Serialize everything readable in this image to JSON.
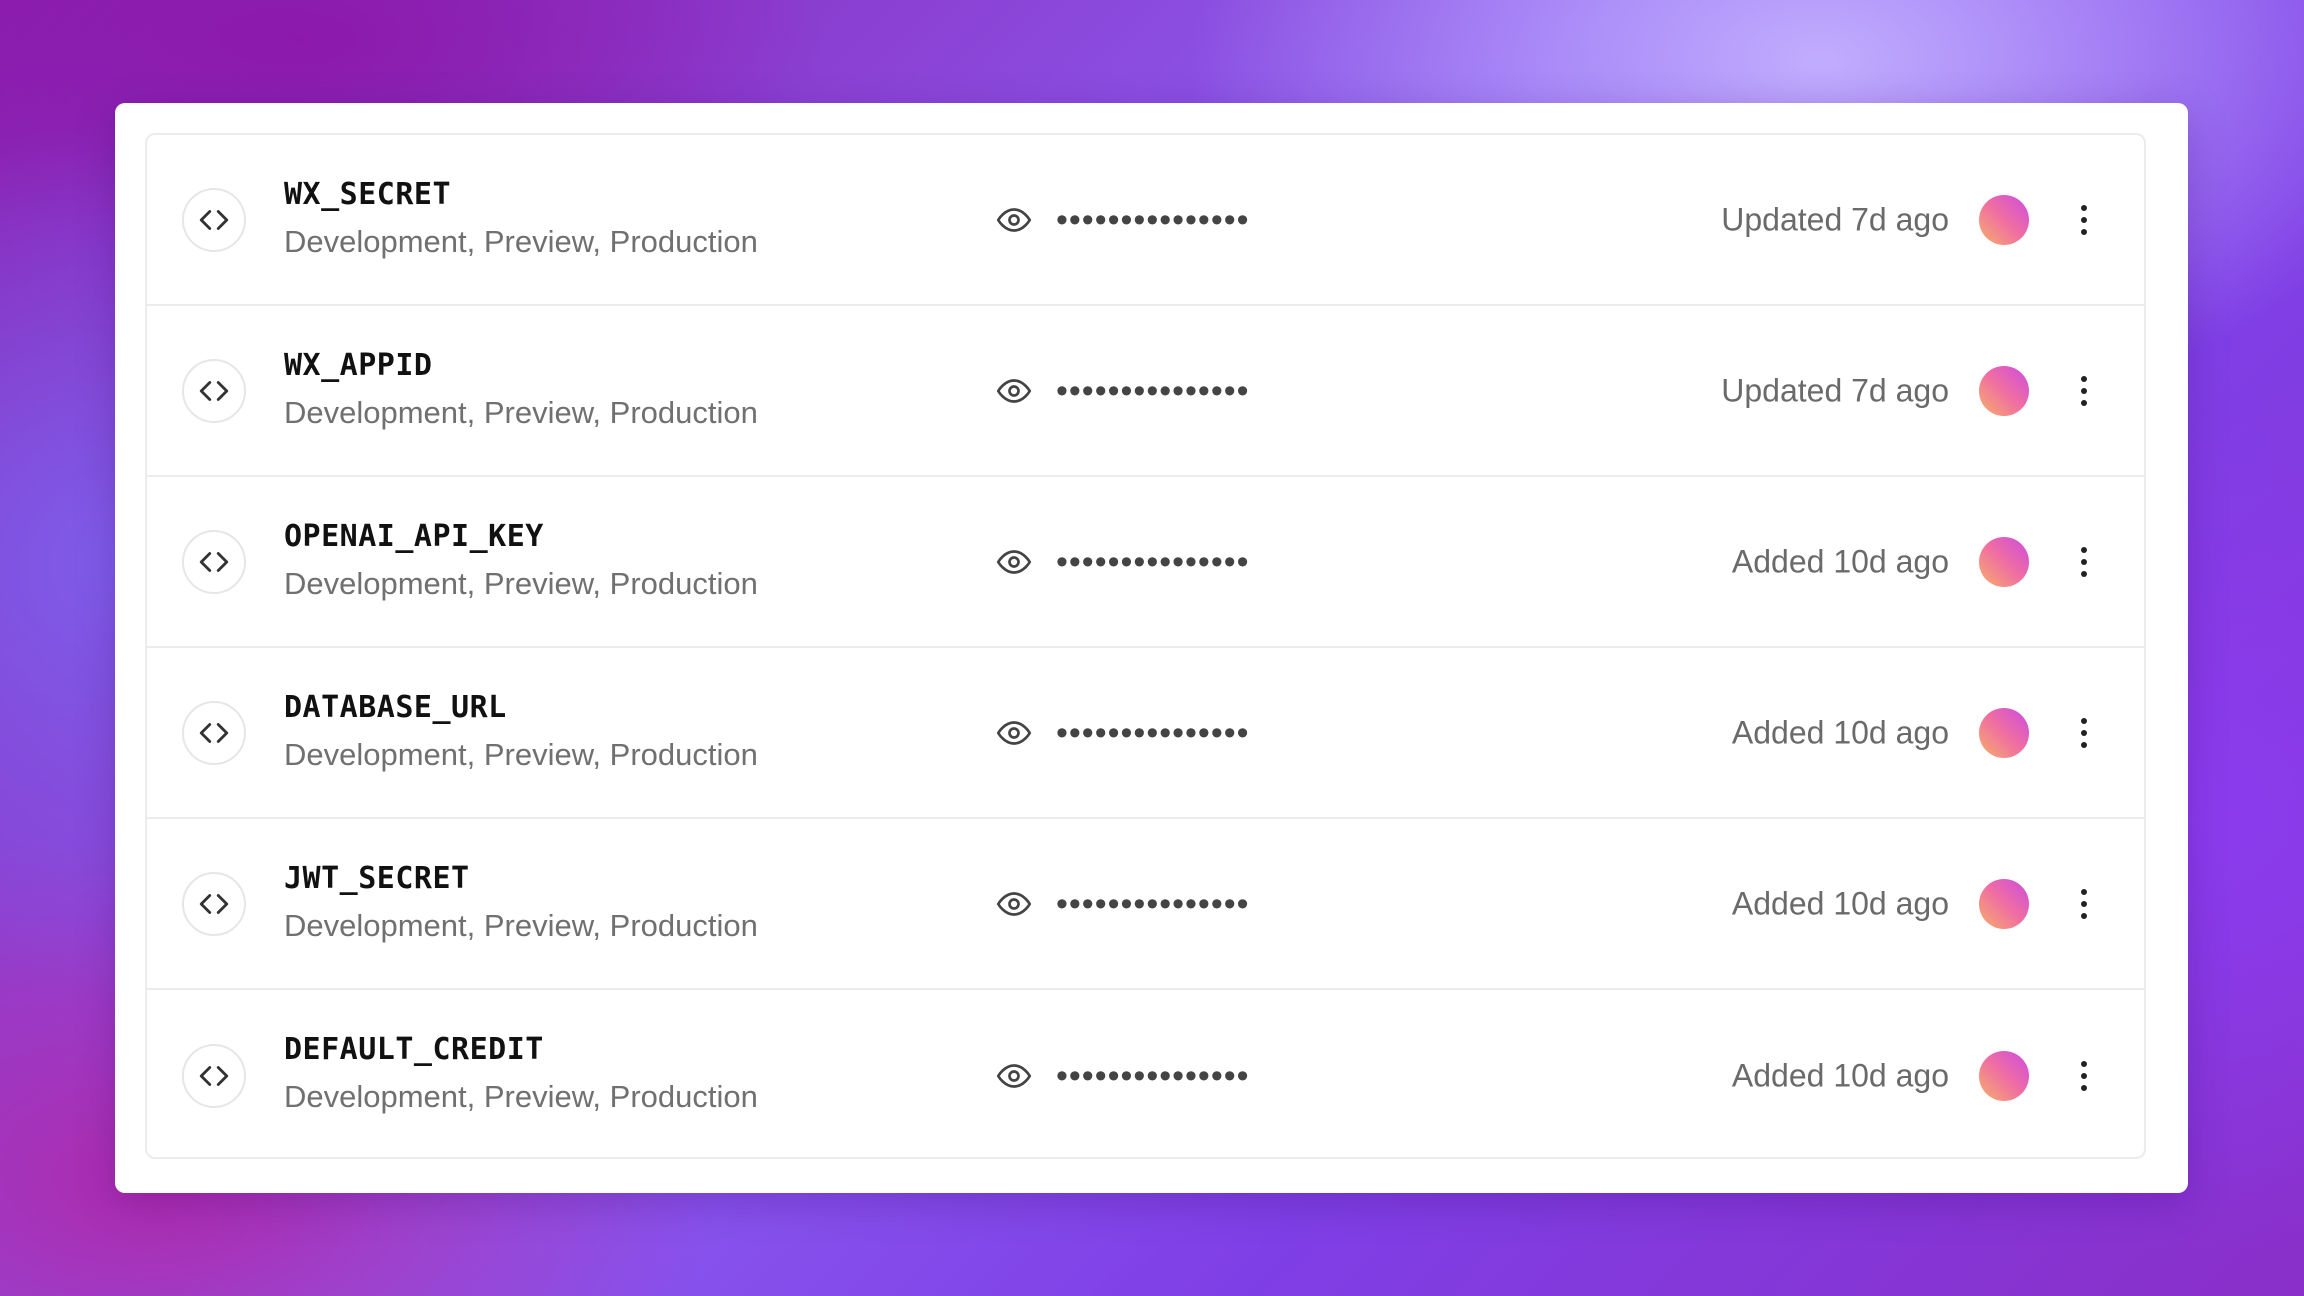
{
  "variables": [
    {
      "name": "WX_SECRET",
      "environments": "Development, Preview, Production",
      "masked_value": "•••••••••••••••",
      "status": "Updated 7d ago",
      "icons": {
        "badge": "code-brackets-icon",
        "reveal": "eye-icon",
        "menu": "more-vertical-icon"
      }
    },
    {
      "name": "WX_APPID",
      "environments": "Development, Preview, Production",
      "masked_value": "•••••••••••••••",
      "status": "Updated 7d ago",
      "icons": {
        "badge": "code-brackets-icon",
        "reveal": "eye-icon",
        "menu": "more-vertical-icon"
      }
    },
    {
      "name": "OPENAI_API_KEY",
      "environments": "Development, Preview, Production",
      "masked_value": "•••••••••••••••",
      "status": "Added 10d ago",
      "icons": {
        "badge": "code-brackets-icon",
        "reveal": "eye-icon",
        "menu": "more-vertical-icon"
      }
    },
    {
      "name": "DATABASE_URL",
      "environments": "Development, Preview, Production",
      "masked_value": "•••••••••••••••",
      "status": "Added 10d ago",
      "icons": {
        "badge": "code-brackets-icon",
        "reveal": "eye-icon",
        "menu": "more-vertical-icon"
      }
    },
    {
      "name": "JWT_SECRET",
      "environments": "Development, Preview, Production",
      "masked_value": "•••••••••••••••",
      "status": "Added 10d ago",
      "icons": {
        "badge": "code-brackets-icon",
        "reveal": "eye-icon",
        "menu": "more-vertical-icon"
      }
    },
    {
      "name": "DEFAULT_CREDIT",
      "environments": "Development, Preview, Production",
      "masked_value": "•••••••••••••••",
      "status": "Added 10d ago",
      "icons": {
        "badge": "code-brackets-icon",
        "reveal": "eye-icon",
        "menu": "more-vertical-icon"
      }
    }
  ],
  "colors": {
    "avatar_gradient": [
      "#f6b06b",
      "#f06fa0",
      "#cc4be2"
    ],
    "name_text": "#111111",
    "secondary_text": "#707070"
  }
}
